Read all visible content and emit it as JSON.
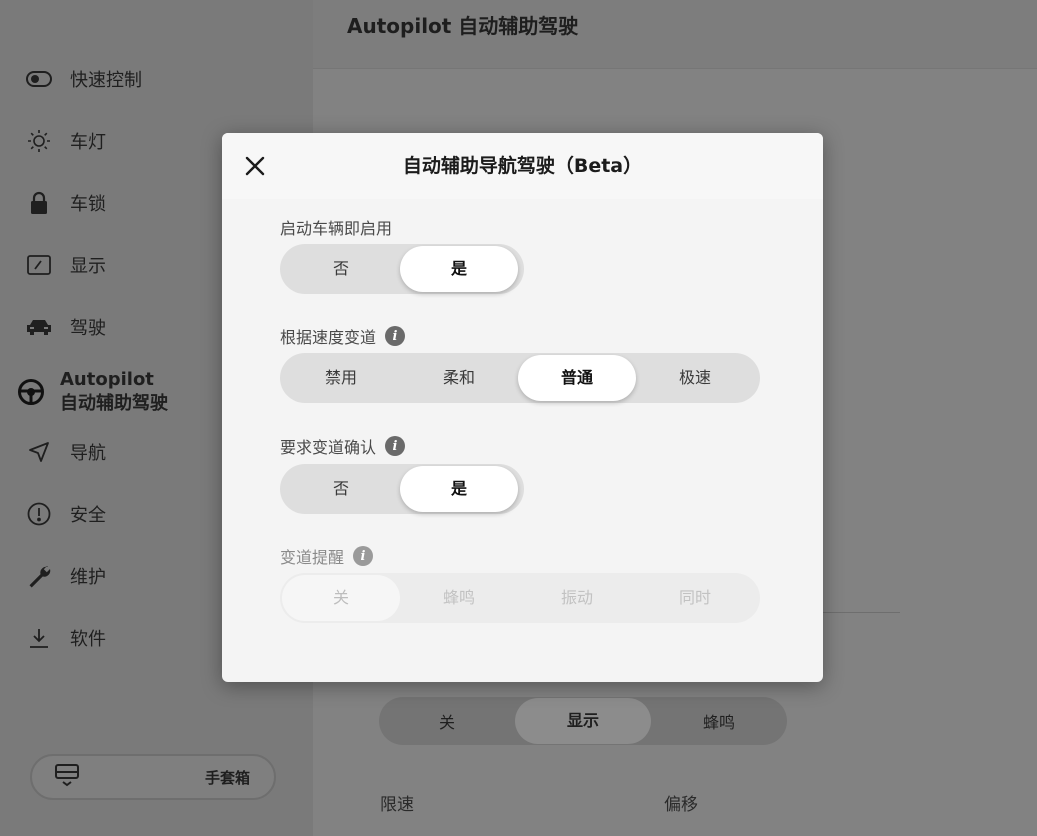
{
  "sidebar": {
    "items": [
      {
        "label": "快速控制",
        "icon": "toggle-icon"
      },
      {
        "label": "车灯",
        "icon": "sun-icon"
      },
      {
        "label": "车锁",
        "icon": "lock-icon"
      },
      {
        "label": "显示",
        "icon": "display-icon"
      },
      {
        "label": "驾驶",
        "icon": "car-icon"
      },
      {
        "label_line1": "Autopilot",
        "label_line2": "自动辅助驾驶",
        "icon": "steering-wheel-icon",
        "active": true
      },
      {
        "label": "导航",
        "icon": "navigation-arrow-icon"
      },
      {
        "label": "安全",
        "icon": "alert-circle-icon"
      },
      {
        "label": "维护",
        "icon": "wrench-icon"
      },
      {
        "label": "软件",
        "icon": "download-icon"
      }
    ],
    "glovebox_label": "手套箱"
  },
  "main": {
    "title": "Autopilot 自动辅助驾驶",
    "bg_segment": {
      "options": [
        "关",
        "显示",
        "蜂鸣"
      ],
      "selected": "显示"
    },
    "bg_labels": {
      "left": "限速",
      "right": "偏移"
    }
  },
  "modal": {
    "title": "自动辅助导航驾驶（Beta）",
    "fields": [
      {
        "label": "启动车辆即启用",
        "has_info": false,
        "options": [
          "否",
          "是"
        ],
        "selected": "是",
        "enabled": true
      },
      {
        "label": "根据速度变道",
        "has_info": true,
        "options": [
          "禁用",
          "柔和",
          "普通",
          "极速"
        ],
        "selected": "普通",
        "enabled": true
      },
      {
        "label": "要求变道确认",
        "has_info": true,
        "options": [
          "否",
          "是"
        ],
        "selected": "是",
        "enabled": true
      },
      {
        "label": "变道提醒",
        "has_info": true,
        "options": [
          "关",
          "蜂鸣",
          "振动",
          "同时"
        ],
        "selected": "关",
        "enabled": false
      }
    ]
  },
  "colors": {
    "overlay": "#7c7c7c",
    "modal_bg": "#f4f4f4",
    "segment_track": "#dedede",
    "segment_selected": "#ffffff"
  }
}
